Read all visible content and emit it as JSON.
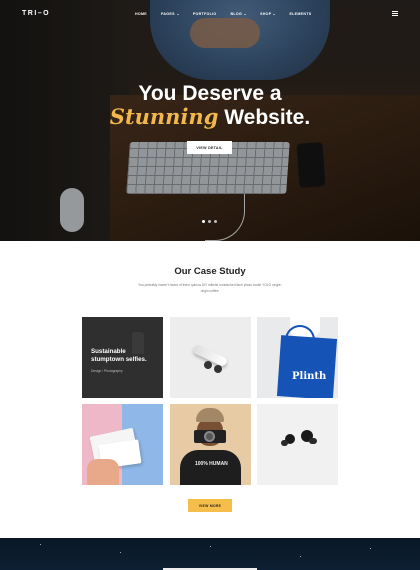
{
  "brand": {
    "logo": "TRI–O"
  },
  "nav": {
    "items": [
      {
        "label": "HOME",
        "dropdown": false
      },
      {
        "label": "PAGES",
        "dropdown": true
      },
      {
        "label": "PORTFOLIO",
        "dropdown": false
      },
      {
        "label": "BLOG",
        "dropdown": true
      },
      {
        "label": "SHOP",
        "dropdown": true
      },
      {
        "label": "ELEMENTS",
        "dropdown": false
      }
    ],
    "menu_icon": "hamburger-icon"
  },
  "hero": {
    "line1": "You Deserve a",
    "accent": "Stunning",
    "line2_rest": " Website.",
    "button": "VIEW DETAIL",
    "slides": 3,
    "active_slide": 1,
    "accent_color": "#f2b84b"
  },
  "case_study": {
    "title": "Our Case Study",
    "description": "You probably haven't heard of them quinoa DIY mlkshk mustache kitsch photo booth YOLO single-origin coffee.",
    "tiles": [
      {
        "title": "Sustainable stumptown selfies.",
        "category": "Design / Photography"
      },
      {
        "title": "",
        "category": ""
      },
      {
        "title": "",
        "category": "",
        "printed_word": "Plinth"
      },
      {
        "title": "",
        "category": ""
      },
      {
        "title": "",
        "category": "",
        "printed_word": "100% HUMAN"
      },
      {
        "title": "",
        "category": ""
      }
    ],
    "button": "VIEW MORE",
    "button_color": "#f5bd4a"
  }
}
